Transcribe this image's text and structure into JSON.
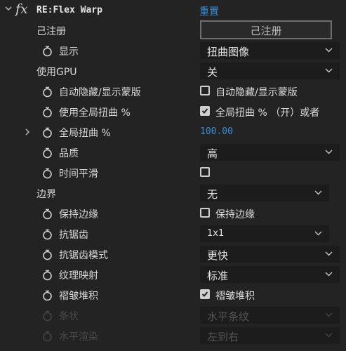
{
  "header": {
    "fx": "fx",
    "title": "RE:Flex Warp",
    "reset": "重置"
  },
  "rows": {
    "registered": {
      "label": "己注册",
      "button": "己注册"
    },
    "display": {
      "label": "显示",
      "value": "扭曲图像"
    },
    "gpu": {
      "label": "使用GPU",
      "value": "关"
    },
    "autohide": {
      "label": "自动隐藏/显示蒙版",
      "checkbox_label": "自动隐藏/显示蒙版",
      "checked": false
    },
    "global_warp": {
      "label": "使用全局扭曲 %",
      "checkbox_label": "全局扭曲 % （开）或者",
      "checked": true
    },
    "global_pct": {
      "label": "全局扭曲 %",
      "value": "100.00"
    },
    "quality": {
      "label": "品质",
      "value": "高"
    },
    "time_smooth": {
      "label": "时间平滑",
      "checked": false
    },
    "border": {
      "label": "边界",
      "value": "无"
    },
    "keep_edge": {
      "label": "保持边缘",
      "checkbox_label": "保持边缘",
      "checked": false
    },
    "antialias": {
      "label": "抗锯齿",
      "value": "1x1"
    },
    "antialias_mode": {
      "label": "抗锯齿模式",
      "value": "更快"
    },
    "texture_map": {
      "label": "纹理映射",
      "value": "标准"
    },
    "wrinkle": {
      "label": "褶皱堆积",
      "checkbox_label": "褶皱堆积",
      "checked": true
    },
    "strips": {
      "label": "条状",
      "value": "水平条纹"
    },
    "horizontal_render": {
      "label": "水平渲染",
      "value": "左到右"
    }
  },
  "colors": {
    "accent": "#3a8dd8",
    "bg": "#232323",
    "dropdown_bg": "#1c1c1c"
  }
}
